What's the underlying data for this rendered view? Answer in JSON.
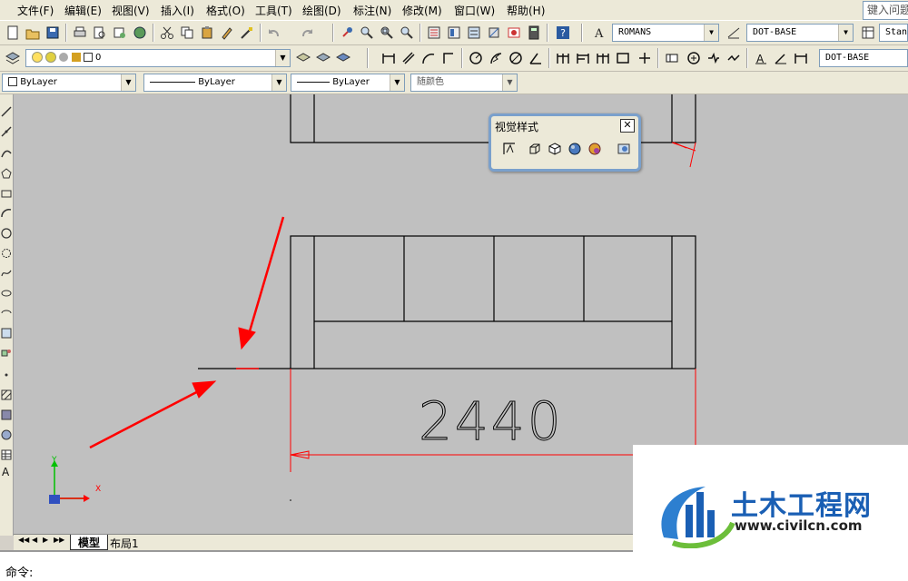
{
  "menubar": {
    "items": [
      "文件(F)",
      "编辑(E)",
      "视图(V)",
      "插入(I)",
      "格式(O)",
      "工具(T)",
      "绘图(D)",
      "标注(N)",
      "修改(M)",
      "窗口(W)",
      "帮助(H)"
    ],
    "help_search": "键入问题"
  },
  "toolbar1": {
    "text_style": "ROMANS",
    "dim_style": "DOT-BASE",
    "table_style": "Stand"
  },
  "toolbar2": {
    "layer": "0",
    "dim_style2": "DOT-BASE"
  },
  "properties": {
    "color": "ByLayer",
    "linetype": "ByLayer",
    "lineweight": "ByLayer",
    "plot_style": "随颜色"
  },
  "visual_styles_panel": {
    "title": "视觉样式",
    "close": "✕"
  },
  "drawing": {
    "dimension_text": "2440",
    "ucs_x": "X",
    "ucs_y": "Y"
  },
  "tabs": {
    "model": "模型",
    "layout1": "布局1",
    "nav": [
      "◀◀",
      "◀",
      "▶",
      "▶▶"
    ]
  },
  "command": {
    "prompt": "命令:"
  },
  "watermark": {
    "brand": "土木工程网",
    "url": "www.civilcn.com"
  },
  "colors": {
    "canvas": "#c0c0c0",
    "dimension": "#ff0000",
    "arrow": "#ff0000",
    "lines": "#000000"
  }
}
